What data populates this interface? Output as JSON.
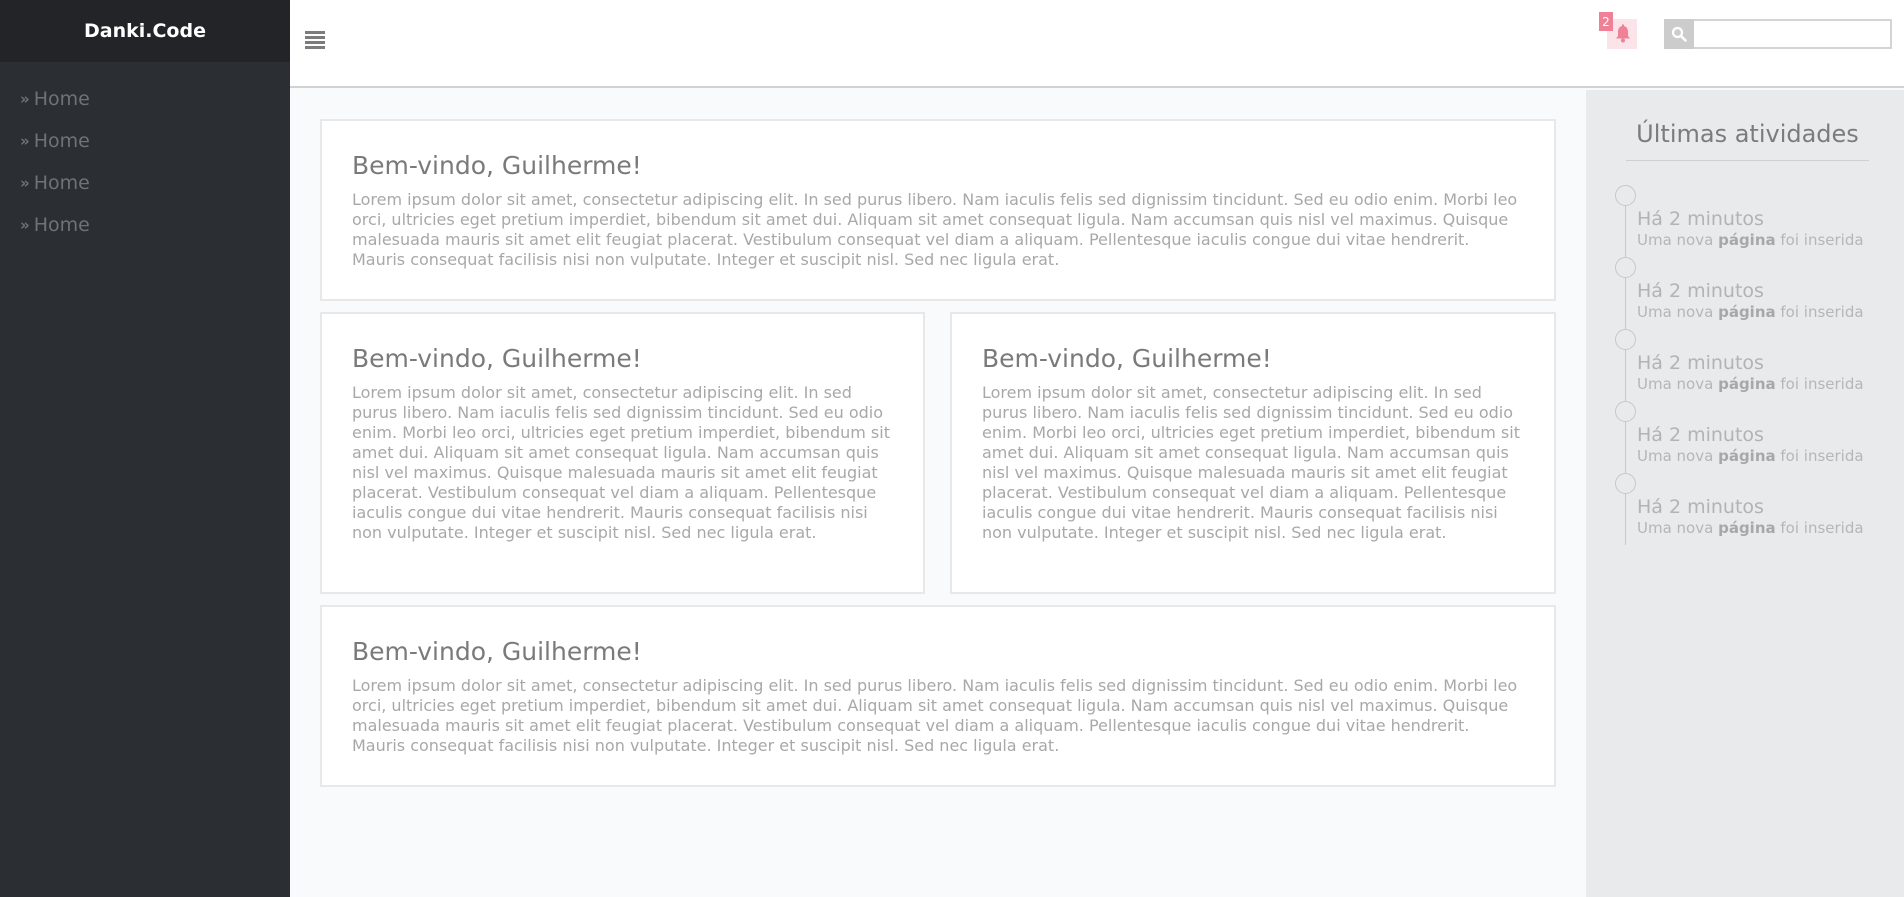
{
  "sidebar": {
    "brand": "Danki.Code",
    "items": [
      {
        "label": "Home"
      },
      {
        "label": "Home"
      },
      {
        "label": "Home"
      },
      {
        "label": "Home"
      }
    ]
  },
  "header": {
    "notification_count": "2",
    "search_placeholder": "",
    "icons": {
      "menu": "hamburger-icon",
      "bell": "bell-icon",
      "search": "search-icon"
    },
    "colors": {
      "bell_accent": "#f08096",
      "bell_bg": "#fbe4e9"
    }
  },
  "cards": [
    {
      "title": "Bem-vindo, Guilherme!",
      "body": "Lorem ipsum dolor sit amet, consectetur adipiscing elit. In sed purus libero. Nam iaculis felis sed dignissim tincidunt. Sed eu odio enim. Morbi leo orci, ultricies eget pretium imperdiet, bibendum sit amet dui. Aliquam sit amet consequat ligula. Nam accumsan quis nisl vel maximus. Quisque malesuada mauris sit amet elit feugiat placerat. Vestibulum consequat vel diam a aliquam. Pellentesque iaculis congue dui vitae hendrerit. Mauris consequat facilisis nisi non vulputate. Integer et suscipit nisl. Sed nec ligula erat."
    },
    {
      "title": "Bem-vindo, Guilherme!",
      "body": "Lorem ipsum dolor sit amet, consectetur adipiscing elit. In sed purus libero. Nam iaculis felis sed dignissim tincidunt. Sed eu odio enim. Morbi leo orci, ultricies eget pretium imperdiet, bibendum sit amet dui. Aliquam sit amet consequat ligula. Nam accumsan quis nisl vel maximus. Quisque malesuada mauris sit amet elit feugiat placerat. Vestibulum consequat vel diam a aliquam. Pellentesque iaculis congue dui vitae hendrerit. Mauris consequat facilisis nisi non vulputate. Integer et suscipit nisl. Sed nec ligula erat."
    },
    {
      "title": "Bem-vindo, Guilherme!",
      "body": "Lorem ipsum dolor sit amet, consectetur adipiscing elit. In sed purus libero. Nam iaculis felis sed dignissim tincidunt. Sed eu odio enim. Morbi leo orci, ultricies eget pretium imperdiet, bibendum sit amet dui. Aliquam sit amet consequat ligula. Nam accumsan quis nisl vel maximus. Quisque malesuada mauris sit amet elit feugiat placerat. Vestibulum consequat vel diam a aliquam. Pellentesque iaculis congue dui vitae hendrerit. Mauris consequat facilisis nisi non vulputate. Integer et suscipit nisl. Sed nec ligula erat."
    },
    {
      "title": "Bem-vindo, Guilherme!",
      "body": "Lorem ipsum dolor sit amet, consectetur adipiscing elit. In sed purus libero. Nam iaculis felis sed dignissim tincidunt. Sed eu odio enim. Morbi leo orci, ultricies eget pretium imperdiet, bibendum sit amet dui. Aliquam sit amet consequat ligula. Nam accumsan quis nisl vel maximus. Quisque malesuada mauris sit amet elit feugiat placerat. Vestibulum consequat vel diam a aliquam. Pellentesque iaculis congue dui vitae hendrerit. Mauris consequat facilisis nisi non vulputate. Integer et suscipit nisl. Sed nec ligula erat."
    }
  ],
  "activity": {
    "title": "Últimas atividades",
    "items": [
      {
        "time": "Há 2 minutos",
        "desc_before": "Uma nova ",
        "desc_bold": "página",
        "desc_after": " foi inserida"
      },
      {
        "time": "Há 2 minutos",
        "desc_before": "Uma nova ",
        "desc_bold": "página",
        "desc_after": " foi inserida"
      },
      {
        "time": "Há 2 minutos",
        "desc_before": "Uma nova ",
        "desc_bold": "página",
        "desc_after": " foi inserida"
      },
      {
        "time": "Há 2 minutos",
        "desc_before": "Uma nova ",
        "desc_bold": "página",
        "desc_after": " foi inserida"
      },
      {
        "time": "Há 2 minutos",
        "desc_before": "Uma nova ",
        "desc_bold": "página",
        "desc_after": " foi inserida"
      }
    ]
  }
}
